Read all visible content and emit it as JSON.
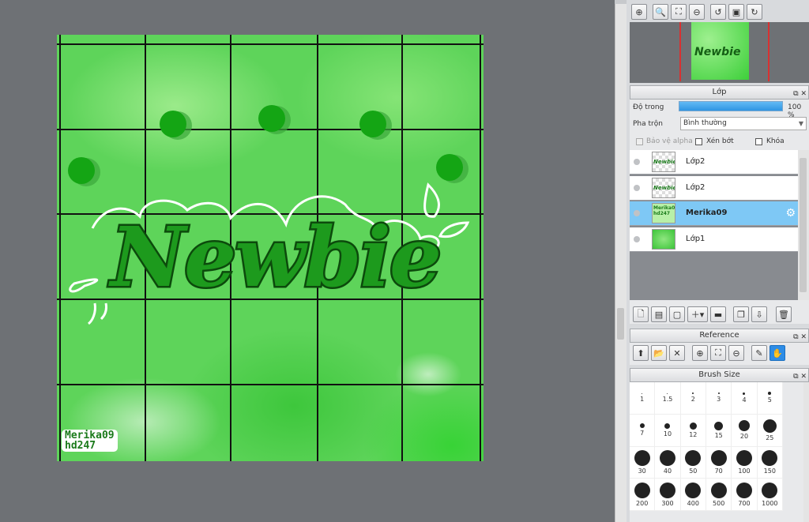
{
  "canvas": {
    "artwork_text": "Newbie",
    "watermark_line1": "Merika09",
    "watermark_line2": "hd247"
  },
  "navigator": {
    "thumb_text": "Newbie"
  },
  "layer_panel": {
    "title": "Lớp",
    "opacity_label": "Độ trong",
    "opacity_value": "100 %",
    "blend_label": "Pha trộn",
    "blend_value": "Bình thường",
    "protect_alpha": "Bảo vệ alpha",
    "clipping": "Xén bớt",
    "lock": "Khóa",
    "layers": [
      {
        "name": "Lớp2",
        "thumb": "Newbie",
        "selected": false
      },
      {
        "name": "Lớp2",
        "thumb": "Newbie",
        "selected": false
      },
      {
        "name": "Merika09",
        "thumb": "Merika09 hd247",
        "selected": true
      },
      {
        "name": "Lớp1",
        "thumb": "",
        "selected": false
      }
    ]
  },
  "reference_panel": {
    "title": "Reference"
  },
  "brush_panel": {
    "title": "Brush Size",
    "sizes": [
      "1",
      "1.5",
      "2",
      "3",
      "4",
      "5",
      "7",
      "10",
      "12",
      "15",
      "20",
      "25",
      "30",
      "40",
      "50",
      "70",
      "100",
      "150",
      "200",
      "300",
      "400",
      "500",
      "700",
      "1000"
    ]
  },
  "colors": {
    "selected_layer": "#7ec8f5",
    "opacity_bar": "#2f95e3",
    "canvas_green": "#5ed45a",
    "lettering_dark_green": "#1d7d1d"
  },
  "icons": {
    "navigator_toolbar": [
      "zoom-actual-icon",
      "zoom-in-icon",
      "fit-window-icon",
      "zoom-out-icon",
      "rotate-left-icon",
      "fit-rotate-icon",
      "rotate-right-icon"
    ],
    "layer_toolbar": [
      "new-raster-layer-icon",
      "new-vector-layer-icon",
      "new-layer-icon",
      "new-correction-layer-icon",
      "new-folder-icon",
      "duplicate-layer-icon",
      "merge-layer-icon",
      "delete-layer-icon"
    ],
    "reference_toolbar": [
      "add-image-icon",
      "open-folder-icon",
      "close-icon",
      "zoom-in-icon",
      "fit-window-icon",
      "zoom-out-icon",
      "eyedropper-icon",
      "hand-icon"
    ]
  }
}
